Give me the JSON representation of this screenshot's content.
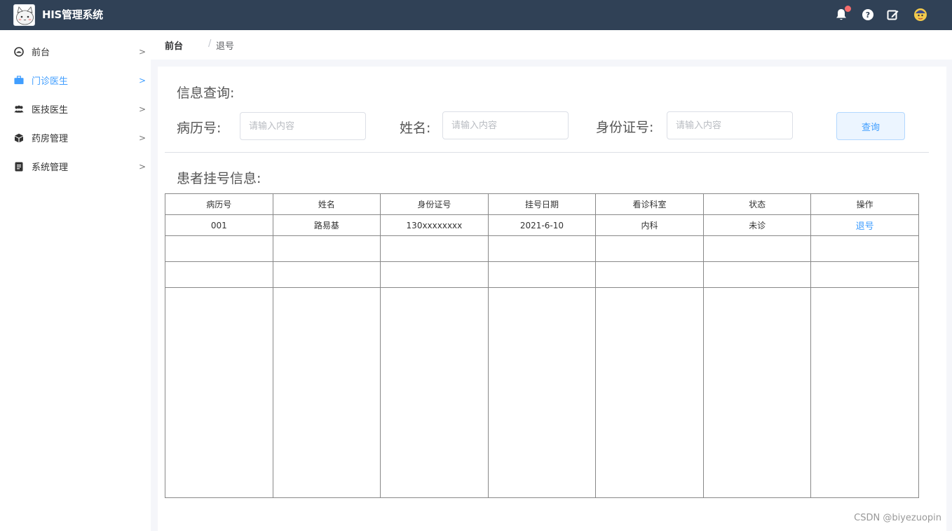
{
  "app": {
    "title": "HIS管理系统",
    "logo_icon": "cat-logo-icon"
  },
  "header": {
    "icons": [
      "bell-icon",
      "help-icon",
      "edit-icon",
      "avatar"
    ],
    "notification_dot_color": "#f56c6c"
  },
  "sidebar": {
    "items": [
      {
        "label": "前台",
        "icon": "dashboard-icon",
        "active": false
      },
      {
        "label": "门诊医生",
        "icon": "briefcase-icon",
        "active": true
      },
      {
        "label": "医技医生",
        "icon": "users-icon",
        "active": false
      },
      {
        "label": "药房管理",
        "icon": "box-icon",
        "active": false
      },
      {
        "label": "系统管理",
        "icon": "document-icon",
        "active": false
      }
    ],
    "arrow": ">"
  },
  "breadcrumb": {
    "parent": "前台",
    "separator": "/",
    "current": "退号"
  },
  "search": {
    "title": "信息查询:",
    "record_label": "病历号:",
    "record_placeholder": "请输入内容",
    "name_label": "姓名:",
    "name_placeholder": "请输入内容",
    "id_label": "身份证号:",
    "id_placeholder": "请输入内容",
    "button_label": "查询"
  },
  "patient": {
    "title": "患者挂号信息:",
    "columns": [
      "病历号",
      "姓名",
      "身份证号",
      "挂号日期",
      "看诊科室",
      "状态",
      "操作"
    ],
    "rows": [
      {
        "record": "001",
        "name": "路易基",
        "id": "130xxxxxxxx",
        "date": "2021-6-10",
        "dept": "内科",
        "status": "未诊",
        "action": "退号"
      }
    ]
  },
  "watermark": "CSDN @biyezuopin",
  "colors": {
    "topbar": "#304156",
    "accent": "#409eff"
  }
}
